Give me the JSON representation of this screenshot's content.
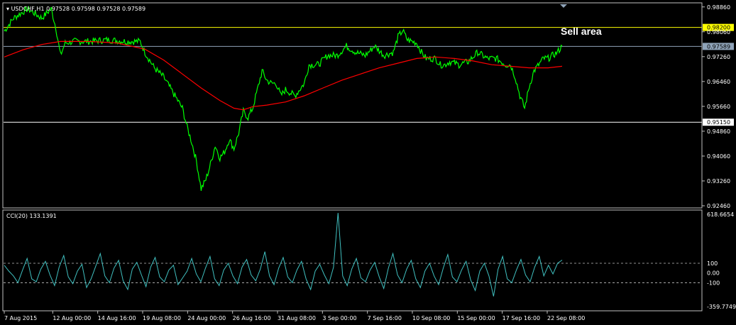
{
  "chart_data": [
    {
      "type": "line",
      "symbol_header": "USDCHF,H1",
      "ohlc": {
        "open": "0.97528",
        "high": "0.97598",
        "low": "0.97528",
        "close": "0.97589"
      },
      "ylim": [
        0.9246,
        0.989
      ],
      "y_ticks": [
        "0.98860",
        "0.98060",
        "0.97260",
        "0.96460",
        "0.95660",
        "0.94860",
        "0.94060",
        "0.93260",
        "0.92460"
      ],
      "series": [
        {
          "color": "#00ff00",
          "points": [
            [
              0,
              0.9808
            ],
            [
              2,
              0.985
            ],
            [
              5,
              0.988
            ],
            [
              8,
              0.985
            ],
            [
              10,
              0.988
            ],
            [
              11,
              0.982
            ],
            [
              12,
              0.973
            ],
            [
              13,
              0.977
            ],
            [
              15,
              0.9775
            ],
            [
              18,
              0.9775
            ],
            [
              22,
              0.978
            ],
            [
              26,
              0.9775
            ],
            [
              29,
              0.9775
            ],
            [
              30,
              0.974
            ],
            [
              32,
              0.969
            ],
            [
              34,
              0.966
            ],
            [
              36,
              0.961
            ],
            [
              38,
              0.956
            ],
            [
              39,
              0.95
            ],
            [
              40,
              0.945
            ],
            [
              41,
              0.939
            ],
            [
              42,
              0.93
            ],
            [
              43,
              0.933
            ],
            [
              44,
              0.938
            ],
            [
              45,
              0.944
            ],
            [
              46,
              0.94
            ],
            [
              47,
              0.942
            ],
            [
              48,
              0.946
            ],
            [
              49,
              0.943
            ],
            [
              50,
              0.948
            ],
            [
              51,
              0.955
            ],
            [
              52,
              0.953
            ],
            [
              53,
              0.956
            ],
            [
              54,
              0.962
            ],
            [
              55,
              0.968
            ],
            [
              56,
              0.965
            ],
            [
              57,
              0.964
            ],
            [
              58,
              0.964
            ],
            [
              59,
              0.96
            ],
            [
              60,
              0.962
            ],
            [
              62,
              0.96
            ],
            [
              64,
              0.964
            ],
            [
              65,
              0.97
            ],
            [
              67,
              0.97
            ],
            [
              69,
              0.973
            ],
            [
              71,
              0.973
            ],
            [
              73,
              0.976
            ],
            [
              75,
              0.974
            ],
            [
              77,
              0.973
            ],
            [
              79,
              0.976
            ],
            [
              81,
              0.973
            ],
            [
              83,
              0.974
            ],
            [
              84,
              0.979
            ],
            [
              85,
              0.981
            ],
            [
              86,
              0.978
            ],
            [
              88,
              0.977
            ],
            [
              89,
              0.974
            ],
            [
              90,
              0.972
            ],
            [
              91,
              0.972
            ],
            [
              92,
              0.972
            ],
            [
              93,
              0.97
            ],
            [
              94,
              0.97
            ],
            [
              95,
              0.971
            ],
            [
              97,
              0.97
            ],
            [
              99,
              0.971
            ],
            [
              101,
              0.974
            ],
            [
              103,
              0.972
            ],
            [
              105,
              0.972
            ],
            [
              107,
              0.97
            ],
            [
              108,
              0.97
            ],
            [
              109,
              0.966
            ],
            [
              110,
              0.96
            ],
            [
              111,
              0.956
            ],
            [
              112,
              0.963
            ],
            [
              113,
              0.968
            ],
            [
              114,
              0.97
            ],
            [
              115,
              0.972
            ],
            [
              116,
              0.972
            ],
            [
              117,
              0.973
            ],
            [
              118,
              0.974
            ],
            [
              119,
              0.976
            ]
          ]
        },
        {
          "color": "#ff0000",
          "points": [
            [
              0,
              0.9725
            ],
            [
              4,
              0.9748
            ],
            [
              8,
              0.9765
            ],
            [
              12,
              0.9775
            ],
            [
              18,
              0.9775
            ],
            [
              24,
              0.977
            ],
            [
              30,
              0.975
            ],
            [
              34,
              0.9715
            ],
            [
              38,
              0.967
            ],
            [
              42,
              0.9625
            ],
            [
              46,
              0.9585
            ],
            [
              49,
              0.956
            ],
            [
              51,
              0.9555
            ],
            [
              53,
              0.9565
            ],
            [
              56,
              0.957
            ],
            [
              60,
              0.958
            ],
            [
              64,
              0.96
            ],
            [
              68,
              0.9625
            ],
            [
              72,
              0.965
            ],
            [
              76,
              0.967
            ],
            [
              80,
              0.969
            ],
            [
              84,
              0.9705
            ],
            [
              88,
              0.972
            ],
            [
              92,
              0.9725
            ],
            [
              96,
              0.972
            ],
            [
              100,
              0.9712
            ],
            [
              104,
              0.97
            ],
            [
              108,
              0.9695
            ],
            [
              112,
              0.969
            ],
            [
              116,
              0.969
            ],
            [
              119,
              0.9695
            ]
          ]
        }
      ],
      "hlines": [
        {
          "value": 0.982,
          "color": "#ffff00",
          "label": "0.98200"
        },
        {
          "value": 0.9515,
          "color": "#ffffff",
          "label": "0.95150"
        },
        {
          "value": 0.97589,
          "color": "#8fa3b8",
          "label": "0.97589"
        }
      ],
      "annotation": {
        "text": "Sell area"
      }
    },
    {
      "type": "line",
      "indicator_header": "CCI(20) 133.1391",
      "ylim": [
        -359.7749,
        618.6654
      ],
      "y_ticks": [
        "618.6654",
        "100",
        "0.00",
        "-100",
        "-359.7749"
      ],
      "levels": [
        100,
        -100
      ],
      "series": [
        {
          "color": "#40c0c0",
          "values": [
            80,
            20,
            -30,
            -100,
            30,
            150,
            -60,
            -90,
            40,
            120,
            -20,
            -130,
            60,
            180,
            -40,
            -110,
            20,
            90,
            -150,
            -60,
            70,
            200,
            -30,
            -100,
            50,
            130,
            -80,
            -170,
            40,
            110,
            -20,
            -140,
            60,
            160,
            -40,
            -90,
            30,
            80,
            -120,
            -50,
            20,
            150,
            -10,
            -90,
            50,
            170,
            -60,
            -130,
            30,
            100,
            -30,
            -110,
            60,
            140,
            -20,
            -80,
            40,
            220,
            -30,
            -120,
            50,
            160,
            -40,
            -100,
            30,
            120,
            -60,
            -170,
            20,
            90,
            -20,
            -110,
            60,
            618,
            -30,
            -130,
            40,
            150,
            -50,
            -90,
            30,
            110,
            -40,
            -160,
            50,
            200,
            -20,
            -100,
            40,
            130,
            -60,
            -150,
            20,
            100,
            -30,
            -120,
            50,
            190,
            -40,
            -90,
            30,
            120,
            -70,
            -180,
            20,
            100,
            -30,
            -240,
            40,
            170,
            -60,
            -100,
            30,
            140,
            -20,
            -90,
            60,
            170,
            -30,
            80,
            -10,
            100,
            133
          ]
        }
      ]
    }
  ],
  "x_ticks": [
    "7 Aug 2015",
    "12 Aug 00:00",
    "14 Aug 16:00",
    "19 Aug 08:00",
    "24 Aug 00:00",
    "26 Aug 16:00",
    "31 Aug 08:00",
    "3 Sep 00:00",
    "7 Sep 16:00",
    "10 Sep 08:00",
    "15 Sep 00:00",
    "17 Sep 16:00",
    "22 Sep 08:00"
  ]
}
